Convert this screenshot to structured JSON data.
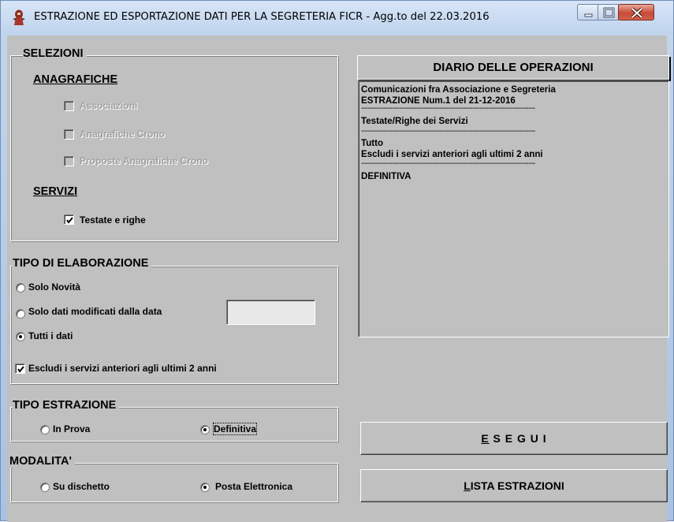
{
  "window": {
    "title": "ESTRAZIONE ED ESPORTAZIONE DATI PER LA SEGRETERIA FICR - Agg.to del 22.03.2016"
  },
  "selezioni": {
    "legend": "SELEZIONI",
    "anagrafiche_title": "ANAGRAFICHE",
    "anagrafiche": [
      {
        "label": "Associazioni",
        "checked": false,
        "enabled": false
      },
      {
        "label": "Anagrafiche Crono",
        "checked": false,
        "enabled": false
      },
      {
        "label": "Proposte Anagrafiche Crono",
        "checked": false,
        "enabled": false
      }
    ],
    "servizi_title": "SERVIZI",
    "servizi": [
      {
        "label": "Testate e righe",
        "checked": true,
        "enabled": true
      }
    ]
  },
  "tipo_elaborazione": {
    "legend": "TIPO DI ELABORAZIONE",
    "options": [
      {
        "label": "Solo  Novità",
        "selected": false
      },
      {
        "label": "Solo dati modificati dalla data",
        "selected": false
      },
      {
        "label": "Tutti i dati",
        "selected": true
      }
    ],
    "date_value": "",
    "escludi": {
      "label": "Escludi i servizi anteriori agli ultimi 2 anni",
      "checked": true
    }
  },
  "tipo_estrazione": {
    "legend": "TIPO  ESTRAZIONE",
    "options": [
      {
        "label": "In  Prova",
        "selected": false
      },
      {
        "label": "Definitiva",
        "selected": true
      }
    ]
  },
  "modalita": {
    "legend": "MODALITA'",
    "options": [
      {
        "label": "Su dischetto",
        "selected": false
      },
      {
        "label": "Posta Elettronica",
        "selected": true
      }
    ]
  },
  "diario": {
    "header": "DIARIO  DELLE  OPERAZIONI",
    "lines": [
      "Comunicazioni fra Associazione e Segreteria",
      "ESTRAZIONE Num.1 del 21-12-2016",
      "------------------------------------------------------------------------------",
      "Testate/Righe dei  Servizi",
      "------------------------------------------------------------------------------",
      "Tutto",
      "Escludi i servizi anteriori agli ultimi 2 anni",
      "------------------------------------------------------------------------------",
      "DEFINITIVA"
    ]
  },
  "buttons": {
    "esegui": "E S E G U I",
    "lista": "LISTA ESTRAZIONI"
  },
  "icons": {
    "app": "app-figure-icon",
    "check": "checkmark-icon"
  }
}
